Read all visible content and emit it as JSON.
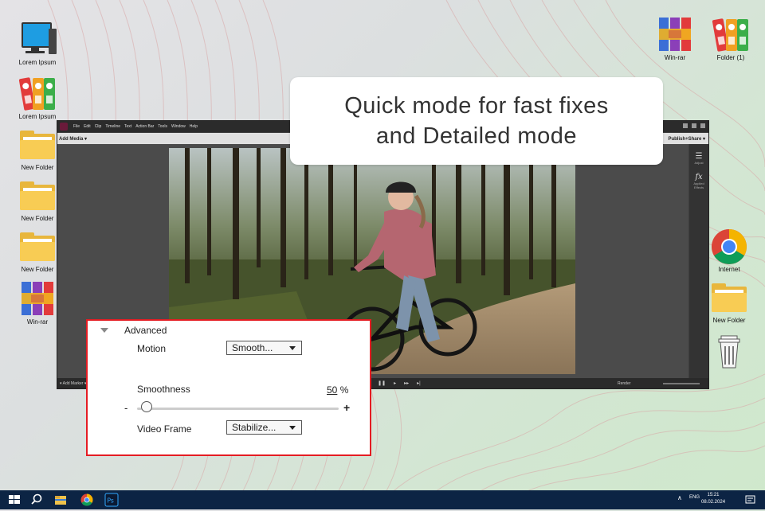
{
  "desktop_left": [
    {
      "name": "computer",
      "label": "Lorem Ipsum"
    },
    {
      "name": "binders",
      "label": "Lorem Ipsum"
    },
    {
      "name": "folder",
      "label": "New Folder"
    },
    {
      "name": "folder",
      "label": "New Folder"
    },
    {
      "name": "folder",
      "label": "New Folder"
    },
    {
      "name": "winrar",
      "label": "Win-rar"
    }
  ],
  "desktop_top_right": [
    {
      "name": "winrar",
      "label": "Win-rar"
    },
    {
      "name": "binders",
      "label": "Folder (1)"
    }
  ],
  "desktop_right": [
    {
      "name": "chrome",
      "label": "Internet"
    },
    {
      "name": "folder",
      "label": "New Folder"
    },
    {
      "name": "trash",
      "label": ""
    }
  ],
  "callout": {
    "line1": "Quick mode for fast fixes",
    "line2": "and Detailed mode"
  },
  "app": {
    "menus": [
      "File",
      "Edit",
      "Clip",
      "Timeline",
      "Text",
      "Action Bar",
      "Tools",
      "Window",
      "Help"
    ],
    "add_media": "Add Media ▾",
    "publish": "Publish+Share ▾",
    "side_adjust": "Adjust",
    "side_effects": "Applied Effects",
    "timeline_label": "▾ Add Marker ▾",
    "render": "Render"
  },
  "advanced": {
    "header": "Advanced",
    "motion_label": "Motion",
    "motion_value": "Smooth...",
    "smoothness_label": "Smoothness",
    "smoothness_value_num": "50",
    "smoothness_value_unit": " %",
    "smoothness": 0.5,
    "minus": "-",
    "plus": "+",
    "videoframe_label": "Video Frame",
    "videoframe_value": "Stabilize..."
  },
  "taskbar": {
    "lang": "ENG",
    "time": "15:21",
    "date": "08.02.2024",
    "chevron": "∧"
  },
  "colors": {
    "accent_red": "#e51c23",
    "taskbar": "#0c2444"
  }
}
